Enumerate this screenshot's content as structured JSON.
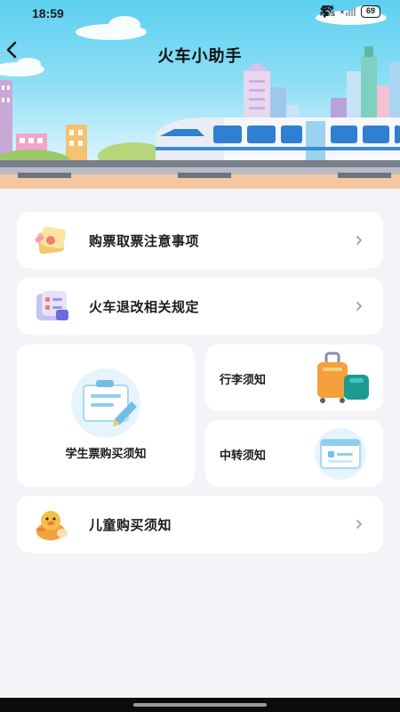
{
  "status_bar": {
    "time": "18:59",
    "net_speed_value": "2.00",
    "net_speed_unit": "KB/S",
    "signal_label": "×",
    "battery": "69"
  },
  "header": {
    "title": "火车小助手",
    "back_icon": "chevron-left-icon"
  },
  "menu": {
    "ticket_notice": {
      "label": "购票取票注意事项",
      "icon": "ticket-notes-icon"
    },
    "refund_rules": {
      "label": "火车退改相关规定",
      "icon": "refund-checklist-icon"
    },
    "student_ticket": {
      "label": "学生票购买须知",
      "icon": "student-document-icon"
    },
    "luggage": {
      "label": "行李须知",
      "icon": "luggage-icon"
    },
    "transfer": {
      "label": "中转须知",
      "icon": "transfer-window-icon"
    },
    "child_ticket": {
      "label": "儿童购买须知",
      "icon": "child-duck-icon"
    }
  },
  "colors": {
    "background": "#f3f4f8",
    "sky_top": "#5cd0f0",
    "card": "#ffffff",
    "text": "#1c1c1c",
    "chevron": "#9a9a9a"
  }
}
